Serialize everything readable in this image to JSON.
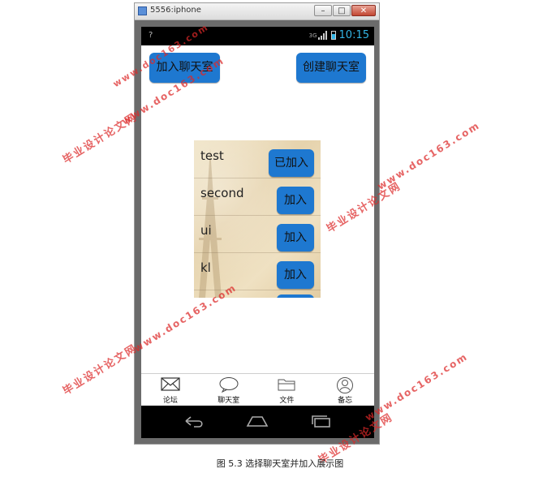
{
  "window": {
    "title": "5556:iphone",
    "minimize_label": "–",
    "maximize_label": "□",
    "close_label": "✕"
  },
  "status_bar": {
    "left_indicator": "?",
    "network_label": "3G",
    "time": "10:15",
    "accent_color": "#33b5e5"
  },
  "toolbar": {
    "join_chat_label": "加入聊天室",
    "create_chat_label": "创建聊天室"
  },
  "rooms": [
    {
      "name": "test",
      "action": "已加入"
    },
    {
      "name": "second",
      "action": "加入"
    },
    {
      "name": "ui",
      "action": "加入"
    },
    {
      "name": "kl",
      "action": "加入"
    }
  ],
  "tabs": [
    {
      "label": "论坛",
      "icon": "mail-icon"
    },
    {
      "label": "聊天室",
      "icon": "chat-bubble-icon"
    },
    {
      "label": "文件",
      "icon": "folder-icon"
    },
    {
      "label": "备忘",
      "icon": "user-circle-icon"
    }
  ],
  "nav": {
    "icons": [
      "back-icon",
      "home-icon",
      "recent-apps-icon"
    ]
  },
  "watermark": {
    "cn": "毕业设计论文网",
    "url": "www.doc163.com"
  },
  "caption": "图 5.3 选择聊天室并加入展示图",
  "colors": {
    "button_blue": "#1e78d0",
    "watermark_red": "#dc2828"
  }
}
